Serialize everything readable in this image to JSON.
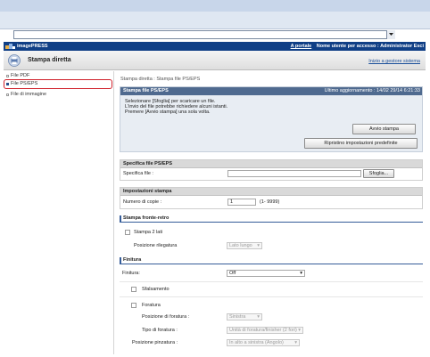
{
  "header": {
    "brand": "imagePRESS",
    "link_portal": "A portale",
    "user_label": "Nome utente per accesso : Administrator Esci"
  },
  "subheader": {
    "title": "Stampa diretta",
    "home_link": "Inizio a gestore sistema"
  },
  "sidebar": {
    "items": [
      {
        "label": "File PDF"
      },
      {
        "label": "File PS/EPS"
      },
      {
        "label": "File di immagine"
      }
    ],
    "selected_index": 1
  },
  "main": {
    "breadcrumb": "Stampa diretta : Stampa file PS/EPS",
    "panel_title": "Stampa file PS/EPS",
    "last_update": "Ultimo aggiornamento : 14/02 29/14 6:21:33",
    "instructions": [
      "Selezionare [Sfoglia] per scaricare un file.",
      "L'invio del file potrebbe richiedere alcuni istanti.",
      "Premere [Avvio stampa] una sola volta."
    ],
    "start_button": "Avvio stampa",
    "restore_button": "Ripristino impostazioni predefinite",
    "spec_section": "Specifica file PS/EPS",
    "spec_file_label": "Specifica file :",
    "browse_button": "Sfoglia...",
    "print_settings_section": "Impostazioni stampa",
    "copies_label": "Numero di copie :",
    "copies_value": "1",
    "copies_range": "(1- 9999)",
    "duplex_section": "Stampa fronte-retro",
    "duplex_checkbox": "Stampa 2 lati",
    "binding_label": "Posizione rilegatura",
    "binding_value": "Lato lungo",
    "finishing_section": "Finitura",
    "finishing_label": "Finitura:",
    "finishing_value": "Off",
    "offset_label": "Sfalsamento",
    "punch_label": "Foratura",
    "punch_position_label": "Posizione di foratura :",
    "punch_position_value": "Sinistra",
    "punch_type_label": "Tipo di foratura :",
    "punch_type_value": "Unità di foratura/finisher (2 fori)",
    "staple_position_label": "Posizione pinzatura :",
    "staple_position_value": "In alto a sinistra (Angolo)"
  },
  "colors": {
    "header_bg": "#103f86",
    "selection_outline": "#d0202a",
    "panel_head": "#4f6a8f"
  }
}
